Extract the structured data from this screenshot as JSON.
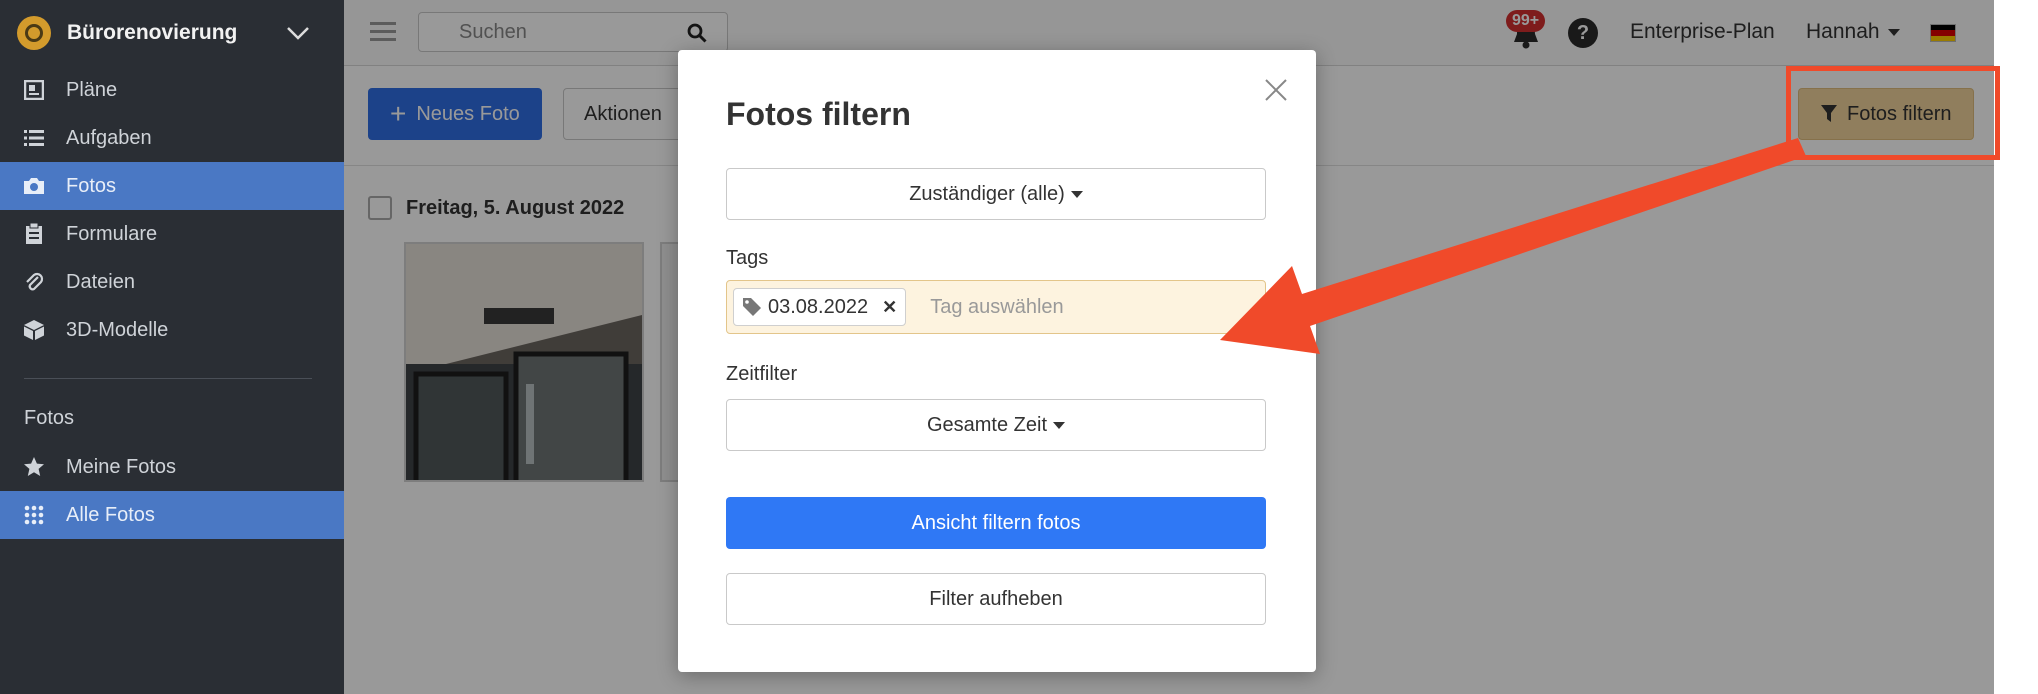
{
  "sidebar": {
    "project": "Bürorenovierung",
    "items": [
      {
        "label": "Pläne",
        "icon": "plans-icon"
      },
      {
        "label": "Aufgaben",
        "icon": "list-icon"
      },
      {
        "label": "Fotos",
        "icon": "camera-icon"
      },
      {
        "label": "Formulare",
        "icon": "clipboard-icon"
      },
      {
        "label": "Dateien",
        "icon": "paperclip-icon"
      },
      {
        "label": "3D-Modelle",
        "icon": "cube-icon"
      }
    ],
    "section_title": "Fotos",
    "sub_items": [
      {
        "label": "Meine Fotos",
        "icon": "star-icon"
      },
      {
        "label": "Alle Fotos",
        "icon": "grid-icon"
      }
    ]
  },
  "topbar": {
    "search_placeholder": "Suchen",
    "notifications_badge": "99+",
    "help": "?",
    "plan": "Enterprise-Plan",
    "user": "Hannah"
  },
  "toolbar": {
    "new_photo": "Neues Foto",
    "actions": "Aktionen",
    "filter_photos": "Fotos filtern"
  },
  "content": {
    "date_group": "Freitag, 5. August 2022"
  },
  "modal": {
    "title": "Fotos filtern",
    "assignee": "Zuständiger (alle)",
    "tags_label": "Tags",
    "tag_chip": "03.08.2022",
    "tag_placeholder": "Tag auswählen",
    "time_label": "Zeitfilter",
    "time_value": "Gesamte Zeit",
    "apply": "Ansicht filtern fotos",
    "reset": "Filter aufheben"
  },
  "colors": {
    "sidebar_bg": "#2a2e34",
    "active": "#4a78c4",
    "primary": "#2f78f5",
    "filter_button": "#f0d29c",
    "highlight": "#f04a2a"
  }
}
